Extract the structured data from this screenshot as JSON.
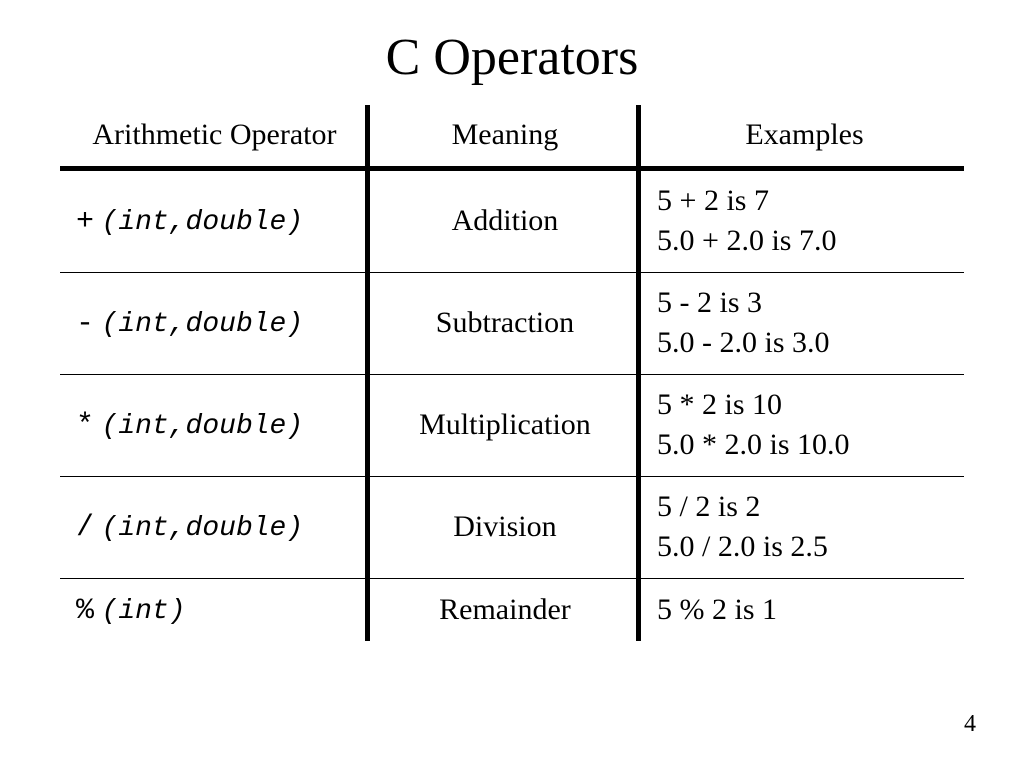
{
  "title": "C Operators",
  "page_number": "4",
  "headers": {
    "operator": "Arithmetic Operator",
    "meaning": "Meaning",
    "examples": "Examples"
  },
  "rows": [
    {
      "symbol": "+",
      "types": "(int,double)",
      "meaning": "Addition",
      "example_line1": "5 + 2 is 7",
      "example_line2": "5.0 + 2.0 is 7.0"
    },
    {
      "symbol": "-",
      "types": "(int,double)",
      "meaning": "Subtraction",
      "example_line1": "5 - 2 is 3",
      "example_line2": "5.0 - 2.0 is 3.0"
    },
    {
      "symbol": "*",
      "types": "(int,double)",
      "meaning": "Multiplication",
      "example_line1": "5 * 2 is 10",
      "example_line2": "5.0 * 2.0 is 10.0"
    },
    {
      "symbol": "/",
      "types": "(int,double)",
      "meaning": "Division",
      "example_line1": "5 / 2 is 2",
      "example_line2": "5.0 / 2.0 is 2.5"
    },
    {
      "symbol": "%",
      "types": "(int)",
      "meaning": "Remainder",
      "example_line1": "5 % 2 is 1",
      "example_line2": ""
    }
  ]
}
